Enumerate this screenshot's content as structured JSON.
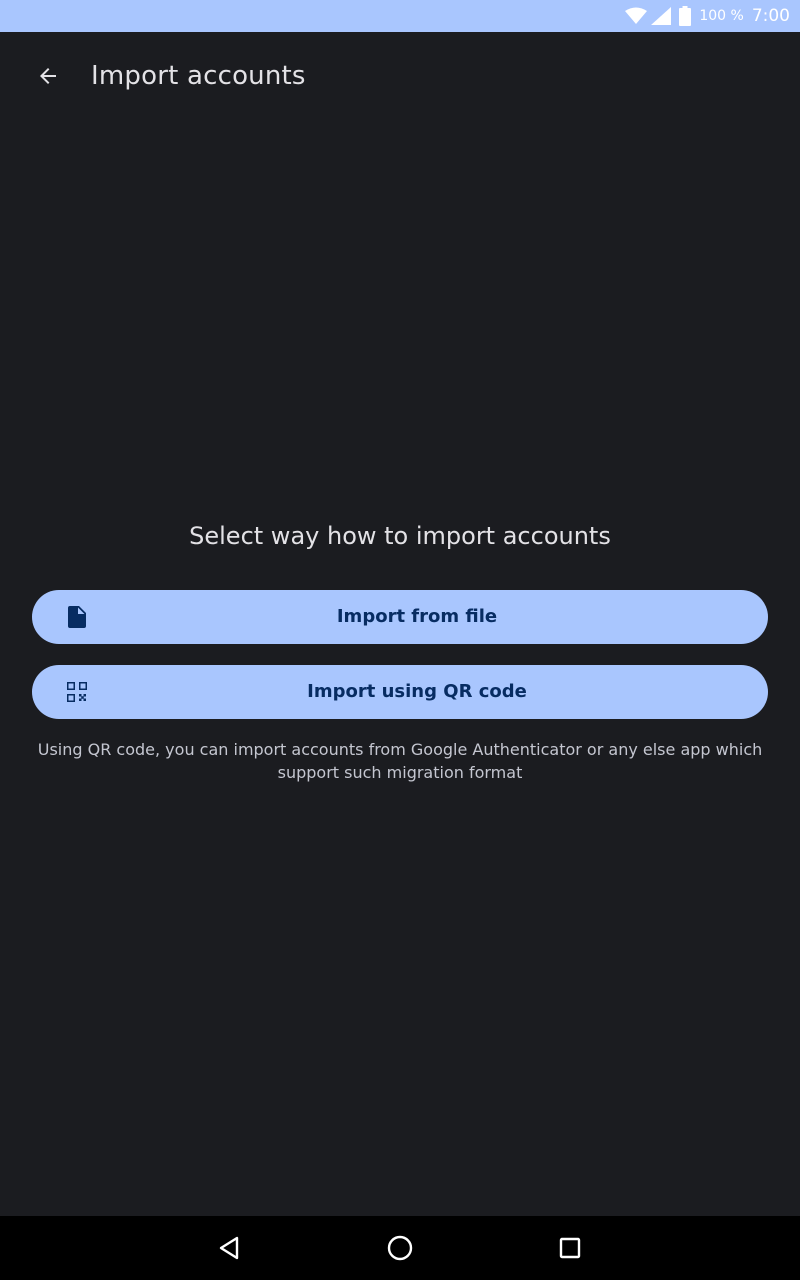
{
  "status_bar": {
    "battery_percent": "100 %",
    "time": "7:00",
    "icons": [
      "wifi-icon",
      "cell-signal-icon",
      "battery-icon"
    ],
    "background": "#a9c6fe"
  },
  "app_bar": {
    "back_icon": "arrow-back-icon",
    "title": "Import accounts"
  },
  "main": {
    "prompt": "Select way how to import accounts",
    "buttons": [
      {
        "label": "Import from file",
        "icon": "file-icon"
      },
      {
        "label": "Import using QR code",
        "icon": "qr-code-icon"
      }
    ],
    "hint": "Using QR code, you can import accounts from Google Authenticator or any else app which support such migration format"
  },
  "nav_bar": {
    "icons": [
      "nav-back-icon",
      "nav-home-icon",
      "nav-recents-icon"
    ]
  },
  "colors": {
    "background": "#1b1c20",
    "button_bg": "#a9c6fe",
    "button_text": "#072c62",
    "text_primary": "#e3e2e6",
    "text_secondary": "#c4c6d0"
  }
}
